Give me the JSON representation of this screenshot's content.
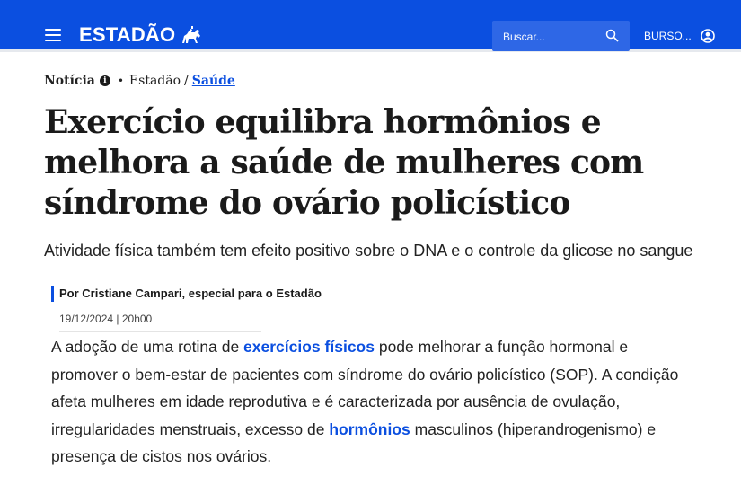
{
  "header": {
    "logo_text": "ESTADÃO",
    "search_placeholder": "Buscar...",
    "account_label": "BURSO...",
    "brand_color": "#0b4fe0"
  },
  "breadcrumb": {
    "type_label": "Notícia",
    "info_glyph": "i",
    "bullet": "•",
    "section": "Estadão",
    "separator": "/",
    "category": "Saúde"
  },
  "article": {
    "title": "Exercício equilibra hormônios e melhora a saúde de mulheres com síndrome do ovário policístico",
    "subtitle": "Atividade física também tem efeito positivo sobre o DNA e o controle da glicose no sangue",
    "byline": "Por Cristiane Campari, especial para o Estadão",
    "date": "19/12/2024 | 20h00",
    "body": {
      "t1": "A adoção de uma rotina de ",
      "link1": "exercícios físicos",
      "t2": " pode melhorar a função hormonal e promover o bem-estar de pacientes com síndrome do ovário policístico (SOP). A condição afeta mulheres em idade reprodutiva e é caracterizada por ausência de ovulação, irregularidades menstruais, excesso de ",
      "link2": "hormônios",
      "t3": " masculinos (hiperandrogenismo) e presença de cistos nos ovários."
    }
  }
}
